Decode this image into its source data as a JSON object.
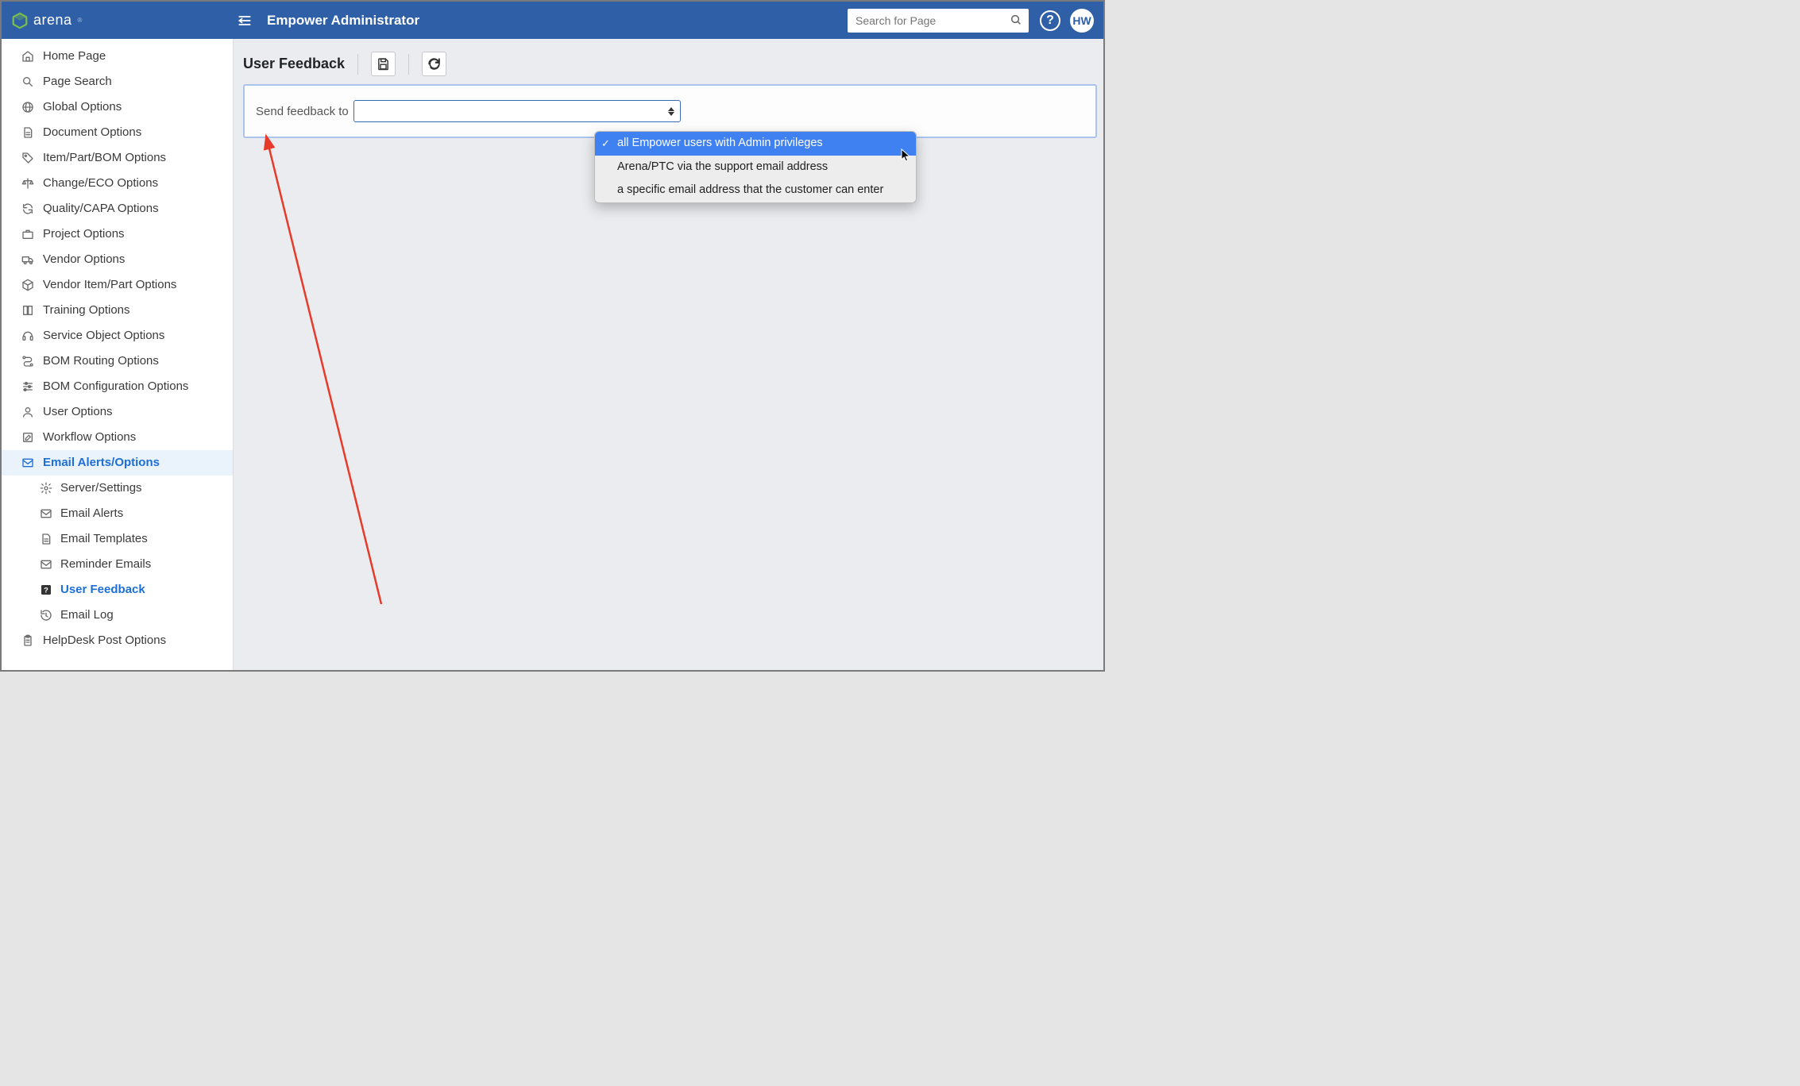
{
  "header": {
    "brand": "arena",
    "title": "Empower Administrator",
    "search_placeholder": "Search for Page",
    "avatar_initials": "HW"
  },
  "page": {
    "title": "User Feedback",
    "form_label": "Send feedback to"
  },
  "dropdown": {
    "options": [
      "all Empower users with Admin privileges",
      "Arena/PTC via the support email address",
      "a specific email address that the customer can enter"
    ],
    "selected_index": 0
  },
  "sidebar": {
    "items": [
      {
        "icon": "home",
        "label": "Home Page"
      },
      {
        "icon": "search",
        "label": "Page Search"
      },
      {
        "icon": "globe",
        "label": "Global Options"
      },
      {
        "icon": "doc",
        "label": "Document Options"
      },
      {
        "icon": "tag",
        "label": "Item/Part/BOM Options"
      },
      {
        "icon": "scale",
        "label": "Change/ECO Options"
      },
      {
        "icon": "refresh",
        "label": "Quality/CAPA Options"
      },
      {
        "icon": "briefcase",
        "label": "Project Options"
      },
      {
        "icon": "truck",
        "label": "Vendor Options"
      },
      {
        "icon": "box",
        "label": "Vendor Item/Part Options"
      },
      {
        "icon": "book",
        "label": "Training Options"
      },
      {
        "icon": "headset",
        "label": "Service Object Options"
      },
      {
        "icon": "route",
        "label": "BOM Routing Options"
      },
      {
        "icon": "sliders",
        "label": "BOM Configuration Options"
      },
      {
        "icon": "user",
        "label": "User Options"
      },
      {
        "icon": "edit",
        "label": "Workflow Options"
      },
      {
        "icon": "mail",
        "label": "Email Alerts/Options",
        "active": true,
        "children": [
          {
            "icon": "gear",
            "label": "Server/Settings"
          },
          {
            "icon": "mail",
            "label": "Email Alerts"
          },
          {
            "icon": "doc",
            "label": "Email Templates"
          },
          {
            "icon": "mail",
            "label": "Reminder Emails"
          },
          {
            "icon": "question",
            "label": "User Feedback",
            "active": true
          },
          {
            "icon": "history",
            "label": "Email Log"
          }
        ]
      },
      {
        "icon": "clipboard",
        "label": "HelpDesk Post Options"
      }
    ]
  }
}
